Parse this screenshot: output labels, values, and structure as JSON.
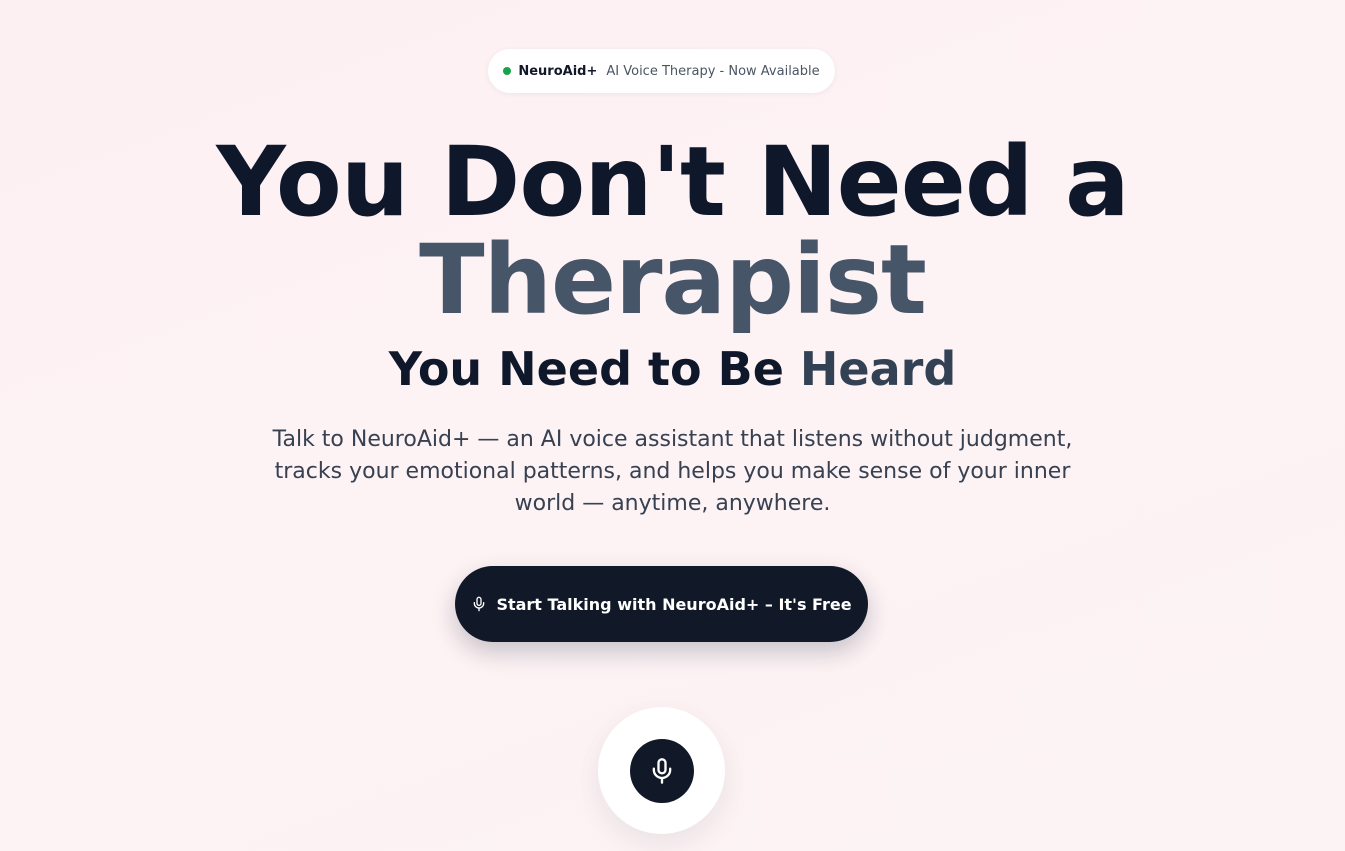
{
  "colors": {
    "status_dot": "#16a34a",
    "primary_dark": "#111827",
    "heading_dark": "#0f172a",
    "heading_muted": "#475569",
    "accent_muted": "#334155",
    "body_text": "#374151"
  },
  "badge": {
    "brand": "NeuroAid+",
    "text": "AI Voice Therapy - Now Available",
    "status_icon": "online-dot-icon"
  },
  "hero": {
    "headline_line1": "You Don't Need a",
    "headline_line2": "Therapist",
    "subhead_prefix": "You Need to Be ",
    "subhead_accent": "Heard",
    "description": "Talk to NeuroAid+ — an AI voice assistant that listens without judgment, tracks your emotional patterns, and helps you make sense of your inner world — anytime, anywhere."
  },
  "cta": {
    "label": "Start Talking with NeuroAid+ – It's Free",
    "icon": "microphone-icon"
  },
  "mic_button": {
    "icon": "microphone-icon"
  }
}
